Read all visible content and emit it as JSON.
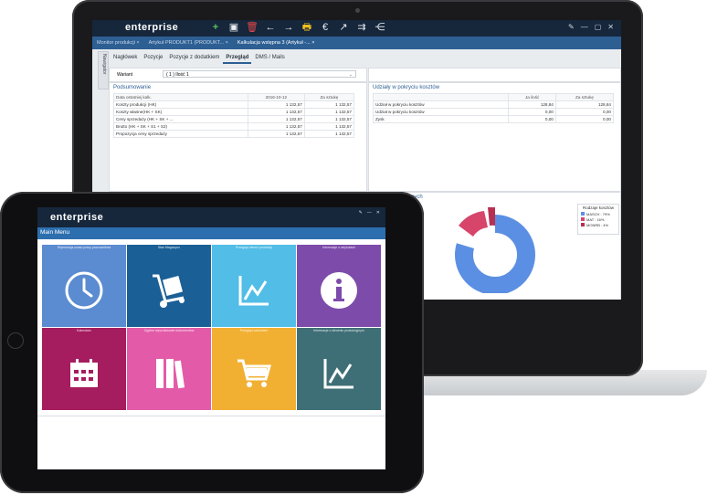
{
  "laptop": {
    "brand": "enterprise",
    "toolbar": [
      "+",
      "▣",
      "🗑",
      "←",
      "→",
      "🖶",
      "€",
      "↗",
      "⇉",
      "⋲"
    ],
    "window_controls": [
      "✎",
      "—",
      "▢",
      "✕"
    ],
    "tabs": [
      {
        "label": "Monitor produkcji  ×"
      },
      {
        "label": "Artykuł PRODUKT1 (PRODUKT...  ×"
      },
      {
        "label": "Kalkulacja wstępna 3 (Artykuł -...  ×"
      }
    ],
    "sidebar_label": "Nawigator",
    "subtabs": [
      "Nagłówek",
      "Pozycje",
      "Pozycje z dodatkiem",
      "Przegląd",
      "DMS / Mails"
    ],
    "variant": {
      "label": "Wariant",
      "value": "( 1 ) Ilość 1"
    },
    "summary": {
      "title": "Podsumowanie",
      "headers": [
        "Data ostatniej kalk.",
        "2016-10-12",
        "Za sztukę"
      ],
      "rows": [
        {
          "label": "Koszty produkcji (HK)",
          "a": "1 132,57",
          "b": "1 132,57"
        },
        {
          "label": "Koszty własne(HK + SK)",
          "a": "1 132,57",
          "b": "1 132,57"
        },
        {
          "label": "Ceny sprzedaży (HK + SK + ...",
          "a": "1 132,57",
          "b": "1 132,57"
        },
        {
          "label": "Brutto (HK + SK + S1 + S2)",
          "a": "1 132,57",
          "b": "1 132,57"
        },
        {
          "label": "Propozycja ceny sprzedaży",
          "a": "1 132,57",
          "b": "1 132,57"
        }
      ]
    },
    "shares": {
      "title": "Udziały w pokryciu kosztów",
      "headers": [
        "",
        "Ja ilość",
        "Za sztukę"
      ],
      "rows": [
        {
          "label": "Udział w pokryciu kosztów",
          "a": "128,84",
          "b": "128,84"
        },
        {
          "label": "Udział w pokryciu kosztów",
          "a": "0,00",
          "b": "0,00"
        },
        {
          "label": "Zysk",
          "a": "0,00",
          "b": "0,00"
        }
      ]
    },
    "chart": {
      "title_fragment": "nych",
      "legend_title": "Rodzaje kosztów",
      "legend": [
        {
          "name": "MASCH : 79%",
          "color": "#5b8fe3"
        },
        {
          "name": "MAT : 16%",
          "color": "#d8456b"
        },
        {
          "name": "MONRB : 4%",
          "color": "#b83050"
        }
      ]
    }
  },
  "tablet": {
    "brand": "enterprise",
    "window_controls": [
      "✎",
      "—",
      "✕"
    ],
    "menu_title": "Main Menu",
    "tiles": [
      {
        "label": "Rejestracja czasu pracy pracowników",
        "color": "#5b8bd0",
        "icon": "clock-icon"
      },
      {
        "label": "Stan Magazynu",
        "color": "#1a5f96",
        "icon": "hand-truck-icon"
      },
      {
        "label": "Przegląd zleceń produkcji",
        "color": "#52bde6",
        "icon": "chart-icon"
      },
      {
        "label": "Informacje o artykułach",
        "color": "#7d4cab",
        "icon": "info-icon"
      },
      {
        "label": "Kalendarz",
        "color": "#a51d5e",
        "icon": "calendar-icon"
      },
      {
        "label": "Ogólne wyszukiwanie dokumentów",
        "color": "#e35ba8",
        "icon": "books-icon"
      },
      {
        "label": "Przegląd zamówień",
        "color": "#f2b033",
        "icon": "cart-icon"
      },
      {
        "label": "Informacje o zleceniu produkcyjnym",
        "color": "#3f6f76",
        "icon": "line-chart-icon"
      }
    ]
  }
}
